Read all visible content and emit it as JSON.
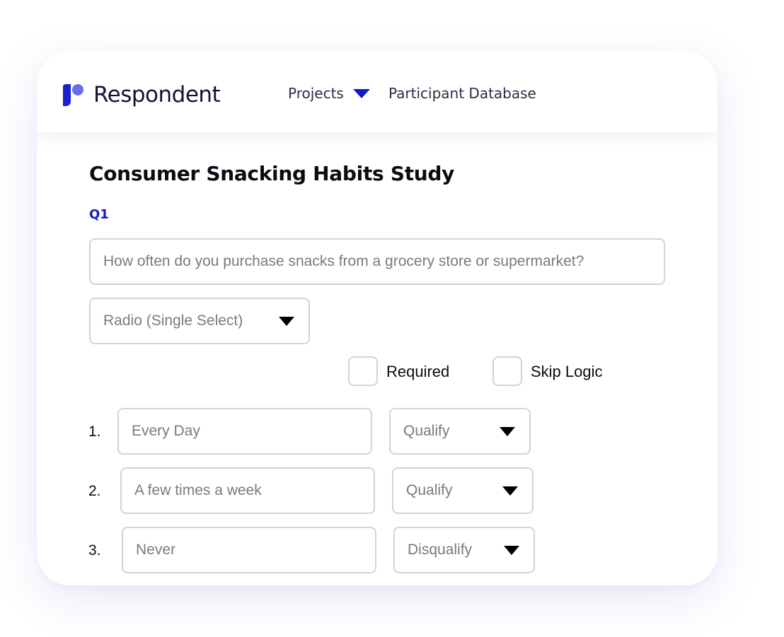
{
  "app": {
    "brand_name": "Respondent",
    "logo_icon": "respondent-logo-icon",
    "accent_color": "#1418c8"
  },
  "nav": {
    "projects_label": "Projects",
    "projects_caret_icon": "caret-down-icon",
    "participant_database_label": "Participant Database"
  },
  "study": {
    "title": "Consumer Snacking Habits Study",
    "question_label": "Q1",
    "question_text": "How often do you purchase snacks from a grocery store or supermarket?",
    "question_type": "Radio (Single Select)",
    "required_label": "Required",
    "skip_logic_label": "Skip Logic",
    "options": [
      {
        "number": "1.",
        "text": "Every Day",
        "logic": "Qualify"
      },
      {
        "number": "2.",
        "text": "A few times a week",
        "logic": "Qualify"
      },
      {
        "number": "3.",
        "text": "Never",
        "logic": "Disqualify"
      }
    ]
  }
}
